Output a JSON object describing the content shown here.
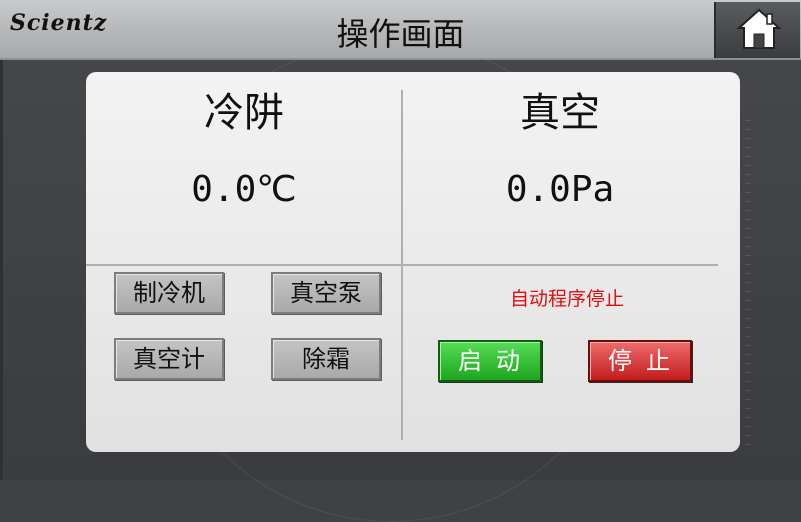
{
  "header": {
    "logo": "Scientz",
    "title": "操作画面",
    "home_icon": "home-icon"
  },
  "left_section": {
    "title": "冷阱",
    "reading": "0.0℃",
    "buttons": {
      "refrigerator": "制冷机",
      "vacuum_pump": "真空泵",
      "vacuum_gauge": "真空计",
      "defrost": "除霜"
    }
  },
  "right_section": {
    "title": "真空",
    "reading": "0.0Pa",
    "status": "自动程序停止",
    "start_label": "启动",
    "stop_label": "停止"
  },
  "colors": {
    "status_text": "#e01010",
    "start_button": "#2bb52b",
    "stop_button": "#d93030"
  }
}
